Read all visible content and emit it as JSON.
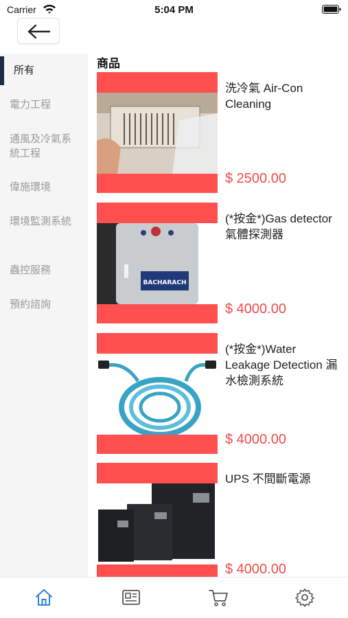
{
  "status_bar": {
    "carrier": "Carrier",
    "time": "5:04 PM"
  },
  "sidebar": {
    "items": [
      {
        "label": "所有",
        "active": true
      },
      {
        "label": "電力工程",
        "active": false
      },
      {
        "label": "通風及冷氣系統工程",
        "active": false
      },
      {
        "label": "偉施環境",
        "active": false
      },
      {
        "label": "環境監測系統",
        "active": false
      },
      {
        "label": "蟲控服務",
        "active": false
      },
      {
        "label": "預約諮詢",
        "active": false
      }
    ]
  },
  "main": {
    "title": "商品",
    "products": [
      {
        "name": "洗冷氣 Air-Con Cleaning",
        "price": "$ 2500.00"
      },
      {
        "name": "(*按金*)Gas detector 氣體探測器",
        "price": "$ 4000.00"
      },
      {
        "name": "(*按金*)Water Leakage Detection 漏水檢測系統",
        "price": "$ 4000.00"
      },
      {
        "name": "UPS 不間斷電源",
        "price": "$ 4000.00"
      }
    ]
  },
  "tabbar": {
    "tabs": [
      {
        "icon": "home-icon",
        "active": true
      },
      {
        "icon": "news-icon",
        "active": false
      },
      {
        "icon": "cart-icon",
        "active": false
      },
      {
        "icon": "gear-icon",
        "active": false
      }
    ]
  },
  "colors": {
    "accent_blue": "#2f7ed8",
    "price_red": "#f04a4a",
    "image_band_red": "#ff4f4f",
    "sidebar_bg": "#f5f5f5",
    "sidebar_indicator": "#1e2a48",
    "inactive_gray": "#9a9a9a"
  }
}
